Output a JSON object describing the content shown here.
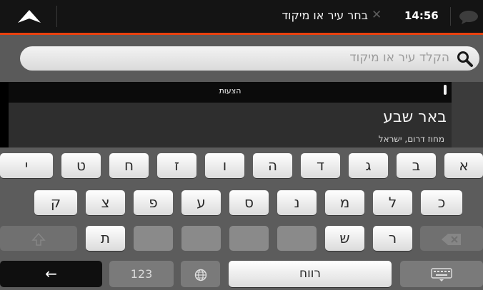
{
  "topbar": {
    "nav_icon": "navigation-arrow-icon",
    "title": "בחר עיר או מיקוד",
    "clear_glyph": "✕",
    "time": "14:56",
    "message_icon": "chat-bubble-icon"
  },
  "search": {
    "placeholder": "הקלד עיר או מיקוד",
    "icon": "search-icon"
  },
  "suggestions": {
    "header": "הצעות",
    "items": [
      {
        "city": "באר שבע",
        "region": "מחוז דרום, ישראל"
      }
    ]
  },
  "keyboard": {
    "row1": [
      "א",
      "ב",
      "ג",
      "ד",
      "ה",
      "ו",
      "ז",
      "ח",
      "ט",
      "י"
    ],
    "row2": [
      "כ",
      "ל",
      "מ",
      "נ",
      "ס",
      "ע",
      "פ",
      "צ",
      "ק"
    ],
    "row3": [
      "ר",
      "ש",
      "ת"
    ],
    "numbers_label": "123",
    "space_label": "רווח",
    "back_glyph": "←",
    "globe_icon": "globe-icon",
    "hide_keyboard_icon": "keyboard-icon",
    "shift_icon": "shift-arrow-icon",
    "backspace_icon": "backspace-icon"
  },
  "colors": {
    "accent": "#e8410f",
    "topbar": "#141414",
    "keyboard_bg": "#5c5c5c"
  }
}
